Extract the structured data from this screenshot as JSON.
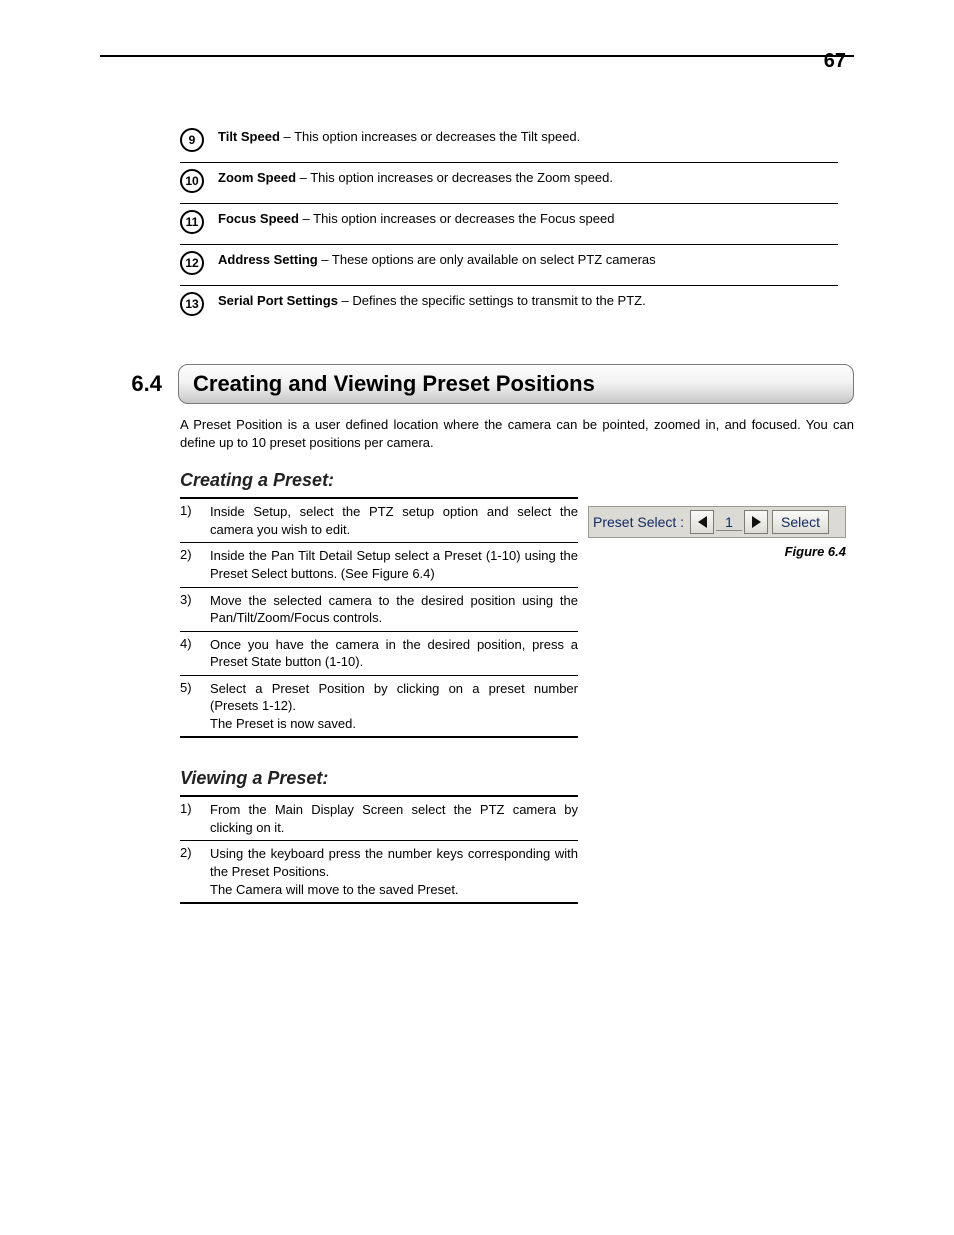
{
  "page_number": "67",
  "defs": [
    {
      "n": "9",
      "term": "Tilt Speed",
      "desc": " – This option increases or decreases the Tilt speed."
    },
    {
      "n": "10",
      "term": "Zoom Speed",
      "desc": " – This option increases or decreases the Zoom speed."
    },
    {
      "n": "11",
      "term": "Focus Speed",
      "desc": " – This option increases or decreases the Focus speed"
    },
    {
      "n": "12",
      "term": "Address Setting",
      "desc": " – These options are only available on select PTZ cameras"
    },
    {
      "n": "13",
      "term": "Serial Port Settings",
      "desc": " – Defines the specific settings to transmit to the PTZ."
    }
  ],
  "section": {
    "num": "6.4",
    "title": "Creating and Viewing Preset Positions"
  },
  "intro": "A Preset Position is a user defined location where the camera can be pointed, zoomed in, and focused. You can define up to 10 preset positions per camera.",
  "subhead_create": "Creating a Preset:",
  "steps_create": [
    {
      "n": "1)",
      "t": "Inside Setup, select the PTZ setup option and select the camera you wish to edit."
    },
    {
      "n": "2)",
      "t": "Inside the Pan Tilt Detail Setup select a Preset (1-10) using the Preset Select buttons. (See Figure 6.4)"
    },
    {
      "n": "3)",
      "t": "Move the selected camera to the desired position using the Pan/Tilt/Zoom/Focus controls."
    },
    {
      "n": "4)",
      "t": "Once you have the camera in the desired position, press a Preset State button (1-10)."
    },
    {
      "n": "5)",
      "t": "Select a Preset Position by clicking on a preset number (Presets 1-12).\nThe Preset is now saved."
    }
  ],
  "subhead_view": "Viewing a Preset:",
  "steps_view": [
    {
      "n": "1)",
      "t": "From the Main Display Screen select the PTZ camera by clicking on it."
    },
    {
      "n": "2)",
      "t": "Using the keyboard press the number keys corresponding with the Preset Positions.\nThe Camera will move to the saved Preset."
    }
  ],
  "figure": {
    "label": "Preset Select :",
    "value": "1",
    "select_label": "Select",
    "caption": "Figure 6.4"
  }
}
